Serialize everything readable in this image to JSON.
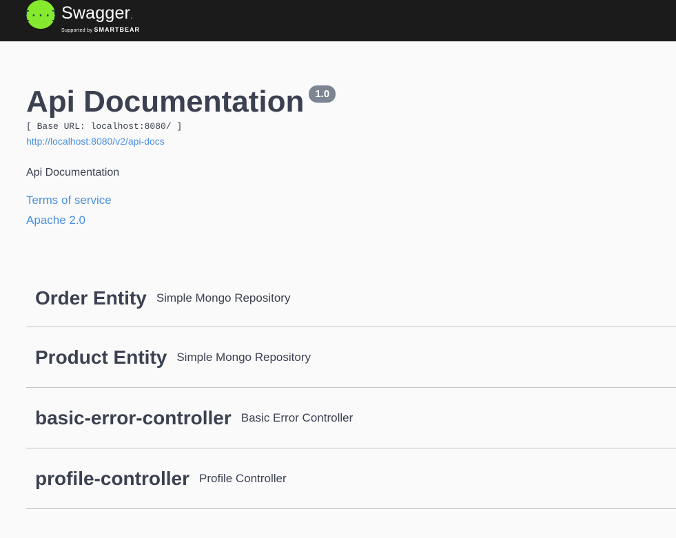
{
  "topbar": {
    "brand_name": "Swagger",
    "brand_sub_prefix": "Supported by",
    "brand_sub_company": "SMARTBEAR",
    "logo_icon": "swagger-braces-icon",
    "accent_color": "#85ea2d",
    "background_color": "#1b1b1b"
  },
  "info": {
    "title": "Api Documentation",
    "version": "1.0",
    "base_url": "[ Base URL: localhost:8080/ ]",
    "docs_link": "http://localhost:8080/v2/api-docs",
    "description": "Api Documentation",
    "terms_of_service": "Terms of service",
    "license": "Apache 2.0",
    "link_color": "#4990e2"
  },
  "tags": [
    {
      "name": "Order Entity",
      "description": "Simple Mongo Repository"
    },
    {
      "name": "Product Entity",
      "description": "Simple Mongo Repository"
    },
    {
      "name": "basic-error-controller",
      "description": "Basic Error Controller"
    },
    {
      "name": "profile-controller",
      "description": "Profile Controller"
    }
  ]
}
